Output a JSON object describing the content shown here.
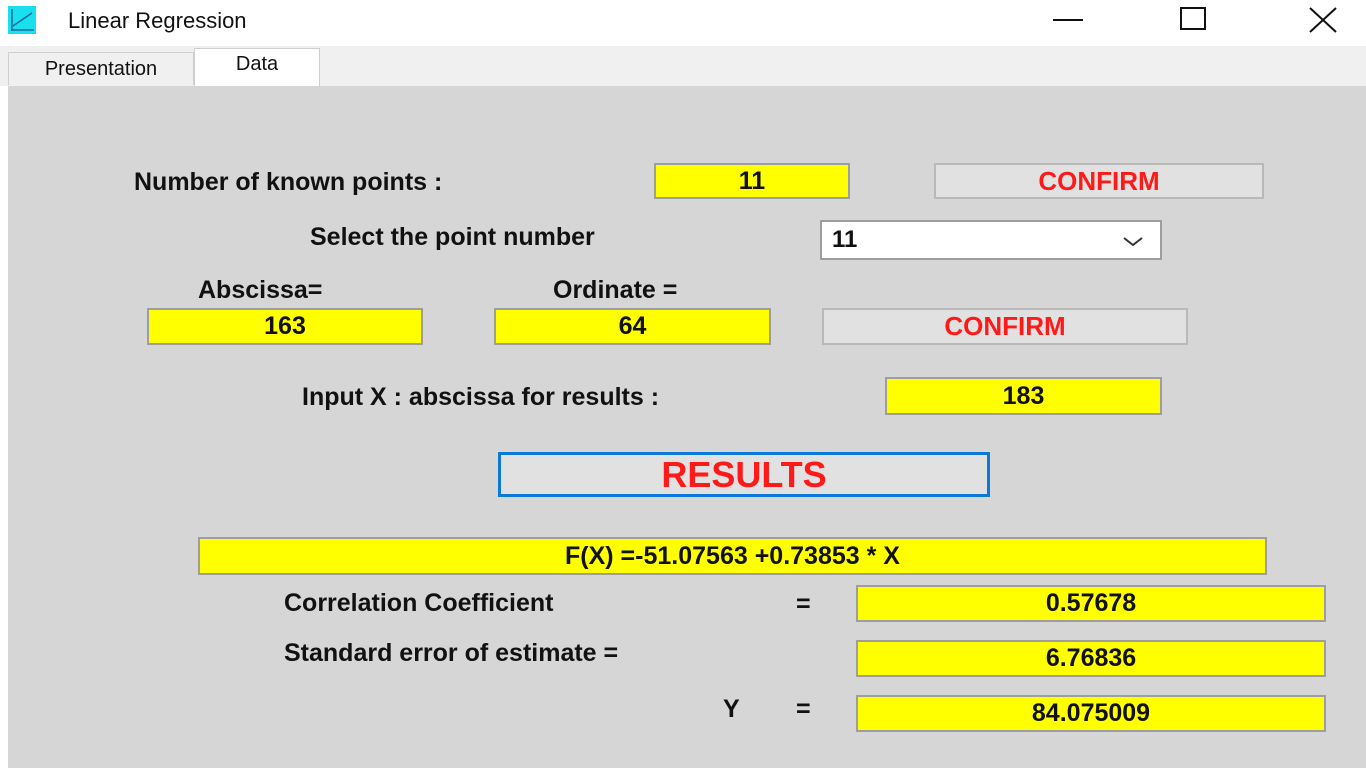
{
  "window": {
    "title": "Linear Regression",
    "icon": "chart-app-icon"
  },
  "tabs": [
    {
      "label": "Presentation",
      "active": false
    },
    {
      "label": "Data",
      "active": true
    }
  ],
  "form": {
    "known_points": {
      "label": "Number of known points :",
      "value": "11",
      "confirm": "CONFIRM"
    },
    "select_point": {
      "label": "Select the point number",
      "value": "11"
    },
    "point": {
      "abscissa_label": "Abscissa=",
      "abscissa_value": "163",
      "ordinate_label": "Ordinate =",
      "ordinate_value": "64",
      "confirm": "CONFIRM"
    },
    "input_x": {
      "label": "Input X : abscissa for results :",
      "value": "183"
    },
    "results_button": "RESULTS"
  },
  "results": {
    "equation": "F(X) =-51.07563 +0.73853 * X",
    "correlation_label": "Correlation Coefficient",
    "correlation_eq": "=",
    "correlation_value": "0.57678",
    "std_error_label": "Standard error of estimate =",
    "std_error_value": "6.76836",
    "y_label": "Y",
    "y_eq": "=",
    "y_value": "84.075009"
  },
  "colors": {
    "field_bg": "#ffff00",
    "button_text": "#ff1a1a",
    "panel_bg": "#d6d6d6",
    "focus_border": "#0c78d7"
  }
}
